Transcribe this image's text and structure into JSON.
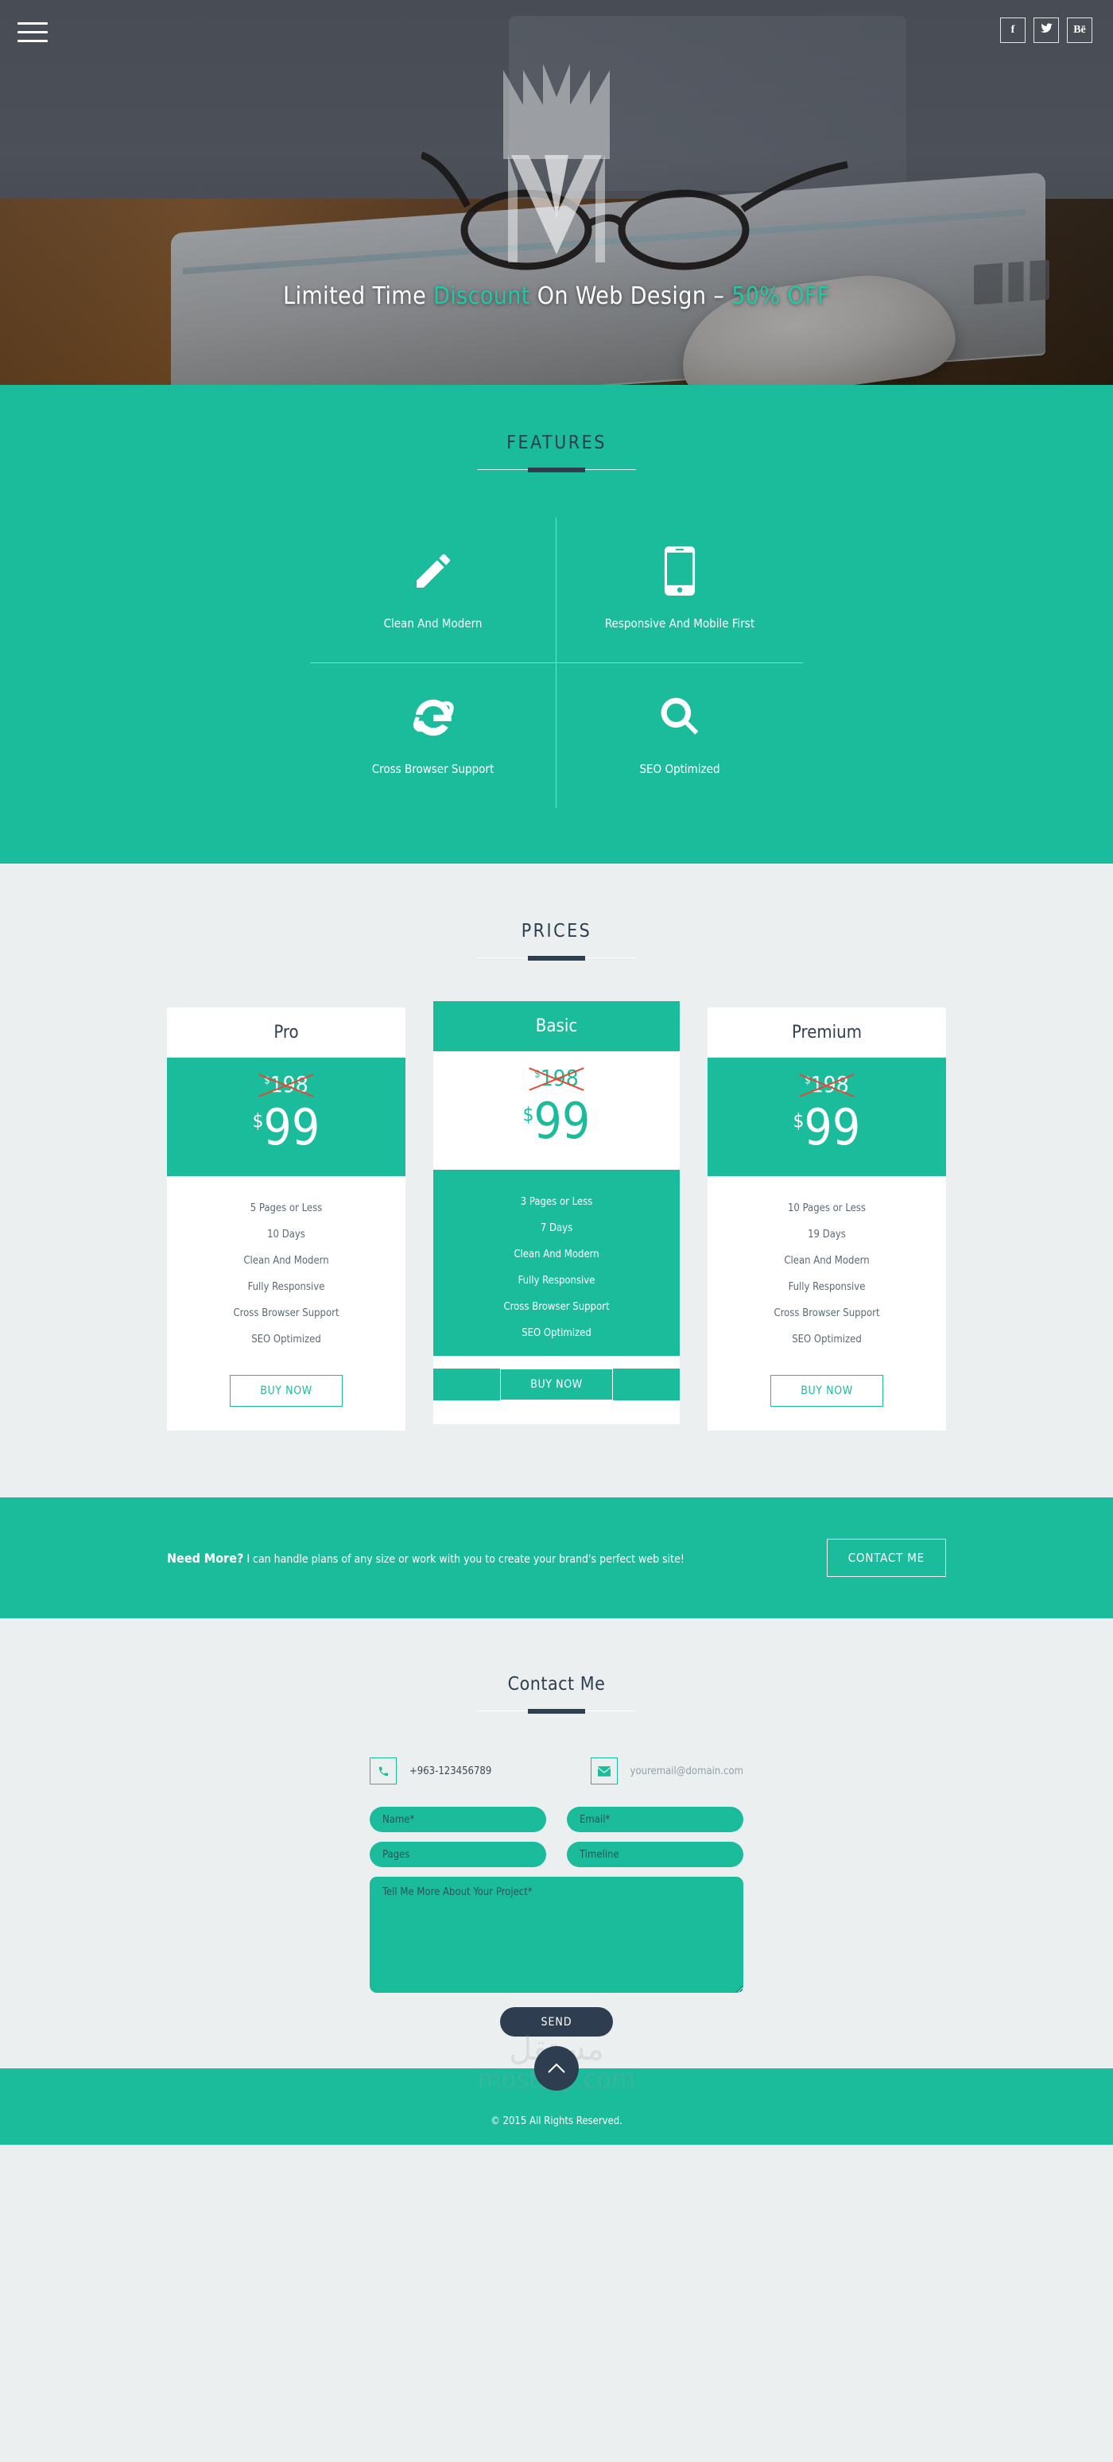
{
  "hero": {
    "menu_icon": "hamburger-menu-icon",
    "social": [
      {
        "name": "facebook",
        "glyph": "f",
        "label": "Facebook"
      },
      {
        "name": "twitter",
        "glyph": "🐦",
        "label": "Twitter"
      },
      {
        "name": "behance",
        "glyph": "Bē",
        "label": "Behance"
      }
    ],
    "tagline_part1": "Limited Time ",
    "tagline_accent1": "Discount",
    "tagline_part2": " On Web Design – ",
    "tagline_accent2": "50% OFF",
    "logo_alt": "crown-m-logo"
  },
  "features": {
    "title": "FEATURES",
    "items": [
      {
        "icon": "pencil-icon",
        "label": "Clean And Modern"
      },
      {
        "icon": "mobile-phone-icon",
        "label": "Responsive And Mobile First"
      },
      {
        "icon": "internet-explorer-icon",
        "label": "Cross Browser Support"
      },
      {
        "icon": "magnifier-icon",
        "label": "SEO Optimized"
      }
    ]
  },
  "prices": {
    "title": "PRICES",
    "currency": "$",
    "cards": [
      {
        "name": "Pro",
        "old_price": "198",
        "new_price": "99",
        "style": "light",
        "features": [
          "5 Pages or Less",
          "10 Days",
          "Clean And Modern",
          "Fully Responsive",
          "Cross Browser Support",
          "SEO Optimized"
        ],
        "cta": "BUY NOW"
      },
      {
        "name": "Basic",
        "old_price": "198",
        "new_price": "99",
        "style": "highlight",
        "features": [
          "3 Pages or Less",
          "7 Days",
          "Clean And Modern",
          "Fully Responsive",
          "Cross Browser Support",
          "SEO Optimized"
        ],
        "cta": "BUY NOW"
      },
      {
        "name": "Premium",
        "old_price": "198",
        "new_price": "99",
        "style": "light",
        "features": [
          "10 Pages or Less",
          "19 Days",
          "Clean And Modern",
          "Fully Responsive",
          "Cross Browser Support",
          "SEO Optimized"
        ],
        "cta": "BUY NOW"
      }
    ]
  },
  "cta": {
    "strong": "Need More?",
    "text": " I can handle plans of any size or work with you to create your brand's perfect web site!",
    "button": "CONTACT ME"
  },
  "contact": {
    "title": "Contact Me",
    "phone_icon": "phone-icon",
    "phone": "+963-123456789",
    "email_icon": "envelope-icon",
    "email": "youremail@domain.com",
    "form": {
      "name_placeholder": "Name*",
      "email_placeholder": "Email*",
      "pages_placeholder": "Pages",
      "timeline_placeholder": "Timeline",
      "message_placeholder": "Tell Me More About Your Project*",
      "submit": "SEND"
    }
  },
  "footer": {
    "watermark_ar": "مستقل",
    "watermark_en": "mostaql.com",
    "to_top_icon": "chevron-up-icon",
    "copyright": "© 2015 All Rights Reserved."
  },
  "colors": {
    "teal": "#1abc9c",
    "navy": "#2e3e50",
    "light_bg": "#eceff0",
    "accent_red": "#e04b35"
  }
}
